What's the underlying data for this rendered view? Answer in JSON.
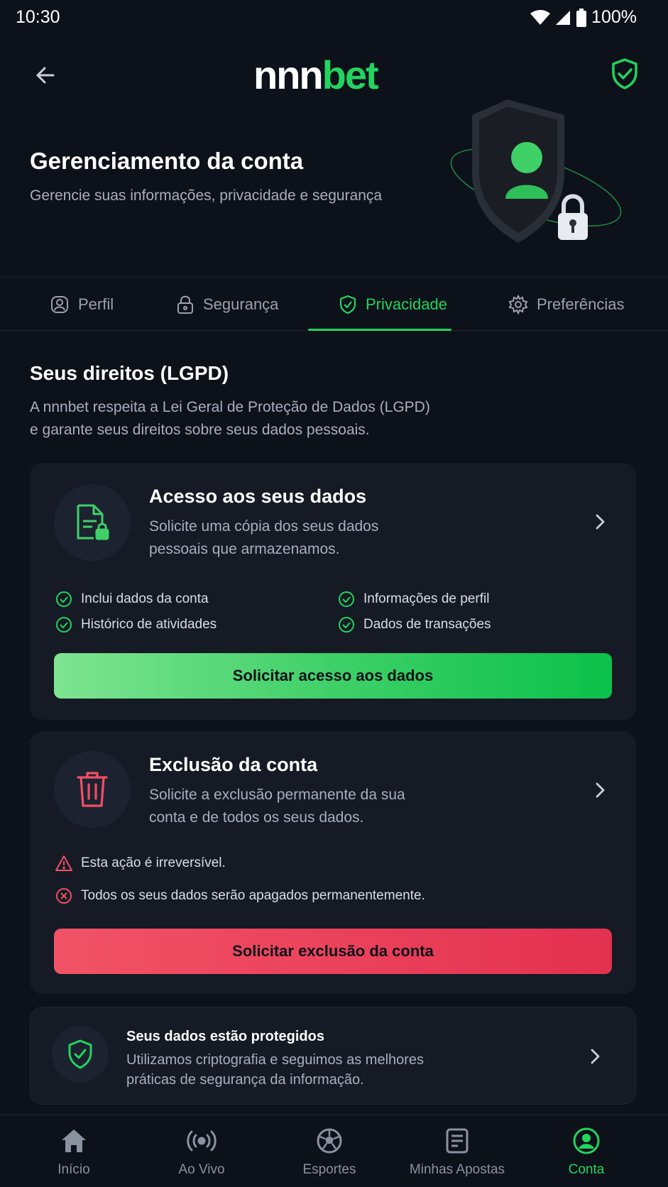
{
  "status_bar": {
    "time": "10:30",
    "battery": "100%"
  },
  "header": {
    "logo_part1": "nnn",
    "logo_part2": "bet"
  },
  "hero": {
    "title": "Gerenciamento da conta",
    "subtitle": "Gerencie suas informações, privacidade e segurança"
  },
  "tabs": [
    {
      "label": "Perfil",
      "icon": "user-icon",
      "active": false
    },
    {
      "label": "Segurança",
      "icon": "lock-icon",
      "active": false
    },
    {
      "label": "Privacidade",
      "icon": "shield-check-icon",
      "active": true
    },
    {
      "label": "Preferências",
      "icon": "gear-icon",
      "active": false
    }
  ],
  "section": {
    "title": "Seus direitos (LGPD)",
    "desc_line1": "A nnnbet respeita a Lei Geral de Proteção de Dados (LGPD)",
    "desc_line2": "e garante seus direitos sobre seus dados pessoais."
  },
  "access_card": {
    "title": "Acesso aos seus dados",
    "desc_line1": "Solicite uma cópia dos seus dados",
    "desc_line2": "pessoais que armazenamos.",
    "items": [
      "Inclui dados da conta",
      "Informações de perfil",
      "Histórico de atividades",
      "Dados de transações"
    ],
    "button": "Solicitar acesso aos dados"
  },
  "delete_card": {
    "title": "Exclusão da conta",
    "desc_line1": "Solicite a exclusão permanente da sua",
    "desc_line2": "conta e de todos os seus dados.",
    "warning1": "Esta ação é irreversível.",
    "warning2": "Todos os seus dados serão apagados permanentemente.",
    "button": "Solicitar exclusão da conta"
  },
  "protect_card": {
    "title": "Seus dados estão protegidos",
    "desc_line1": "Utilizamos criptografia e seguimos as melhores",
    "desc_line2": "práticas de segurança da informação."
  },
  "bottom_nav": [
    {
      "label": "Início",
      "icon": "home-icon",
      "active": false
    },
    {
      "label": "Ao Vivo",
      "icon": "live-icon",
      "active": false
    },
    {
      "label": "Esportes",
      "icon": "soccer-ball-icon",
      "active": false
    },
    {
      "label": "Minhas Apostas",
      "icon": "bet-slip-icon",
      "active": false
    },
    {
      "label": "Conta",
      "icon": "account-icon",
      "active": true
    }
  ],
  "colors": {
    "accent": "#22d45e",
    "danger": "#e33150",
    "background": "#0d111a",
    "card": "#151a25"
  }
}
